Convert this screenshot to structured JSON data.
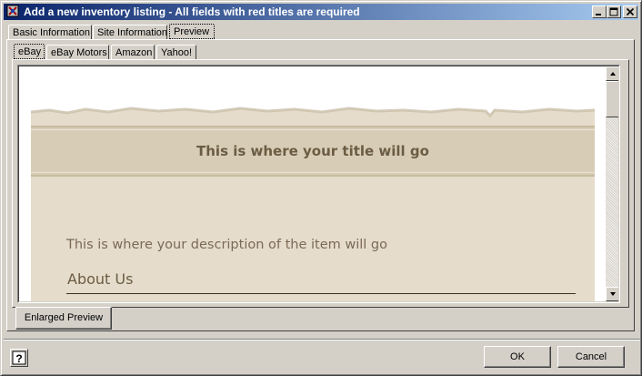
{
  "window": {
    "title": "Add a new inventory listing - All fields with red titles are required",
    "controls": [
      "minimize-icon",
      "maximize-icon",
      "close-icon"
    ]
  },
  "top_tabs": [
    {
      "label": "Basic Information",
      "active": false
    },
    {
      "label": "Site Information",
      "active": false
    },
    {
      "label": "Preview",
      "active": true
    }
  ],
  "site_tabs": [
    {
      "label": "eBay",
      "active": true
    },
    {
      "label": "eBay Motors",
      "active": false
    },
    {
      "label": "Amazon",
      "active": false
    },
    {
      "label": "Yahoo!",
      "active": false
    }
  ],
  "preview": {
    "title_text": "This is where your title will go",
    "description_text": "This is where your description of the item will go",
    "about_heading": "About Us"
  },
  "buttons": {
    "enlarged_preview": "Enlarged Preview",
    "ok": "OK",
    "cancel": "Cancel",
    "help_glyph": "?"
  },
  "colors": {
    "titlebar_start": "#0a246a",
    "titlebar_end": "#a6caf0",
    "parchment": "#e6dccb",
    "title_band": "#d7cdb6",
    "title_text": "#6b5c43"
  },
  "scroll": {
    "position_fraction": 0.0
  }
}
